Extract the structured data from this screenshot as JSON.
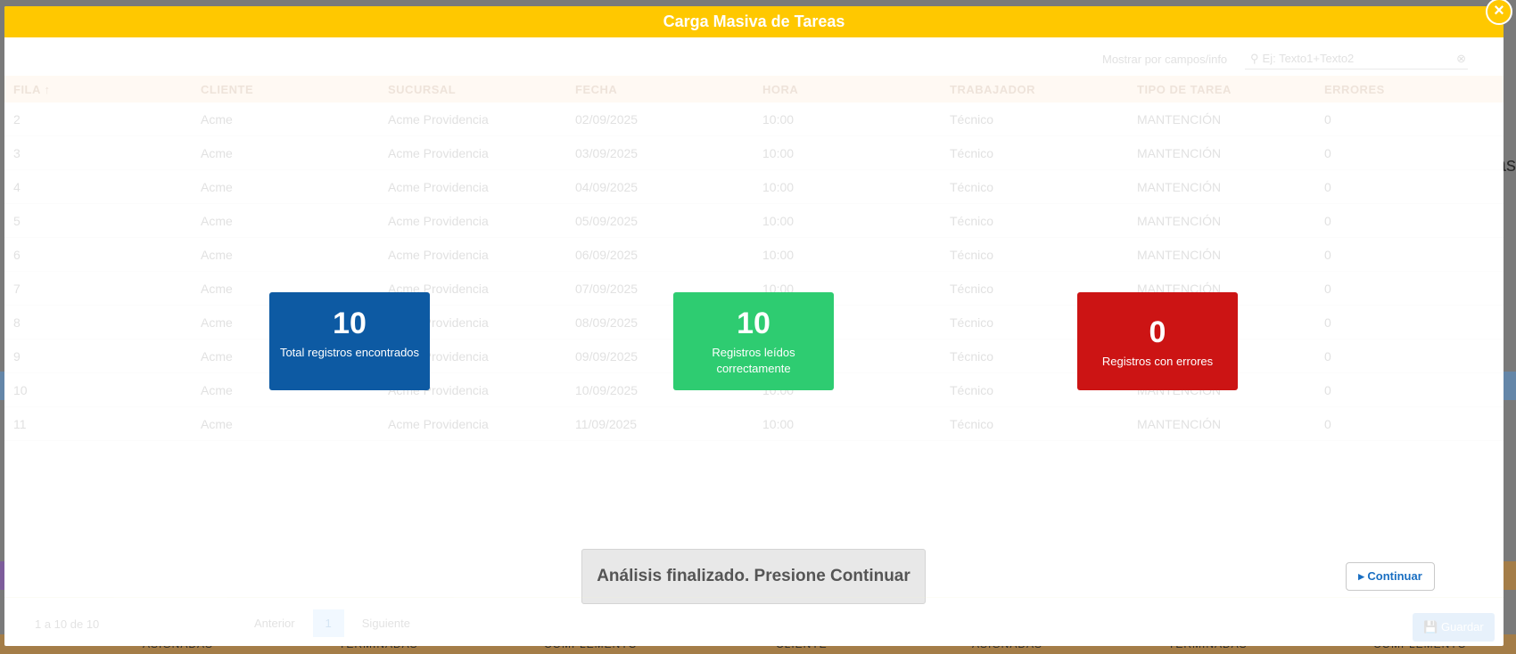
{
  "modal": {
    "title": "Carga Masiva de Tareas",
    "close_icon": "close-icon"
  },
  "search": {
    "label": "Mostrar por campos/info",
    "placeholder": "Ej: Texto1+Texto2"
  },
  "table": {
    "headers": [
      "FILA ↑",
      "CLIENTE",
      "SUCURSAL",
      "FECHA",
      "HORA",
      "TRABAJADOR",
      "TIPO DE TAREA",
      "ERRORES"
    ],
    "rows": [
      [
        "2",
        "Acme",
        "Acme Providencia",
        "02/09/2025",
        "10:00",
        "Técnico",
        "MANTENCIÓN",
        "0"
      ],
      [
        "3",
        "Acme",
        "Acme Providencia",
        "03/09/2025",
        "10:00",
        "Técnico",
        "MANTENCIÓN",
        "0"
      ],
      [
        "4",
        "Acme",
        "Acme Providencia",
        "04/09/2025",
        "10:00",
        "Técnico",
        "MANTENCIÓN",
        "0"
      ],
      [
        "5",
        "Acme",
        "Acme Providencia",
        "05/09/2025",
        "10:00",
        "Técnico",
        "MANTENCIÓN",
        "0"
      ],
      [
        "6",
        "Acme",
        "Acme Providencia",
        "06/09/2025",
        "10:00",
        "Técnico",
        "MANTENCIÓN",
        "0"
      ],
      [
        "7",
        "Acme",
        "Acme Providencia",
        "07/09/2025",
        "10:00",
        "Técnico",
        "MANTENCIÓN",
        "0"
      ],
      [
        "8",
        "Acme",
        "Acme Providencia",
        "08/09/2025",
        "10:00",
        "Técnico",
        "MANTENCIÓN",
        "0"
      ],
      [
        "9",
        "Acme",
        "Acme Providencia",
        "09/09/2025",
        "10:00",
        "Técnico",
        "MANTENCIÓN",
        "0"
      ],
      [
        "10",
        "Acme",
        "Acme Providencia",
        "10/09/2025",
        "10:00",
        "Técnico",
        "MANTENCIÓN",
        "0"
      ],
      [
        "11",
        "Acme",
        "Acme Providencia",
        "11/09/2025",
        "10:00",
        "Técnico",
        "MANTENCIÓN",
        "0"
      ]
    ]
  },
  "cards": {
    "total": {
      "value": "10",
      "label": "Total registros encontrados",
      "color": "#0d5aa3"
    },
    "ok": {
      "value": "10",
      "label": "Registros leídos correctamente",
      "color": "#2ecc71"
    },
    "errors": {
      "value": "0",
      "label": "Registros con errores",
      "color": "#cc1414"
    }
  },
  "status_message": "Análisis finalizado. Presione Continuar",
  "continue_label": "Continuar",
  "footer": {
    "range": "1 a 10 de 10",
    "prev": "Anterior",
    "page": "1",
    "next": "Siguiente",
    "save": "Guardar"
  },
  "background": {
    "bottom_tabs": [
      "ASIGNADAS",
      "TERMINADAS",
      "COMPLEMENTO",
      "CLIENTE",
      "ASIGNADAS",
      "TERMINADAS",
      "COMPLEMENTO"
    ],
    "right_text": "as"
  }
}
